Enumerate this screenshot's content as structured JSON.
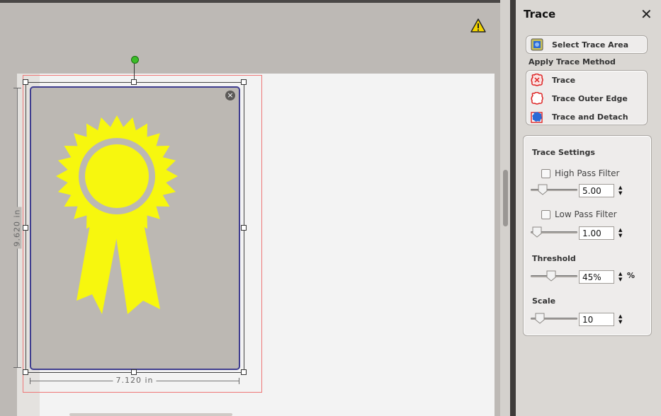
{
  "canvas": {
    "width_dimension": "7.120 in",
    "height_dimension": "9.620 in",
    "close_glyph": "×"
  },
  "panel": {
    "title": "Trace",
    "close_glyph": "✕",
    "select_trace_area": "Select Trace Area",
    "apply_trace_method": "Apply Trace Method",
    "methods": [
      {
        "label": "Trace",
        "icon": "trace-icon"
      },
      {
        "label": "Trace Outer Edge",
        "icon": "trace-outer-edge-icon"
      },
      {
        "label": "Trace and Detach",
        "icon": "trace-and-detach-icon"
      }
    ],
    "settings": {
      "title": "Trace Settings",
      "high_pass_filter": {
        "label": "High Pass Filter",
        "checked": false,
        "value": "5.00"
      },
      "low_pass_filter": {
        "label": "Low Pass Filter",
        "checked": false,
        "value": "1.00"
      },
      "threshold": {
        "label": "Threshold",
        "value": "45%",
        "unit": "%"
      },
      "scale": {
        "label": "Scale",
        "value": "10"
      }
    }
  },
  "colors": {
    "artwork_yellow": "#f7f70e",
    "selection_border": "#3f3d8f",
    "rotate_handle": "#3bbd28",
    "warning": "#f2d400"
  }
}
